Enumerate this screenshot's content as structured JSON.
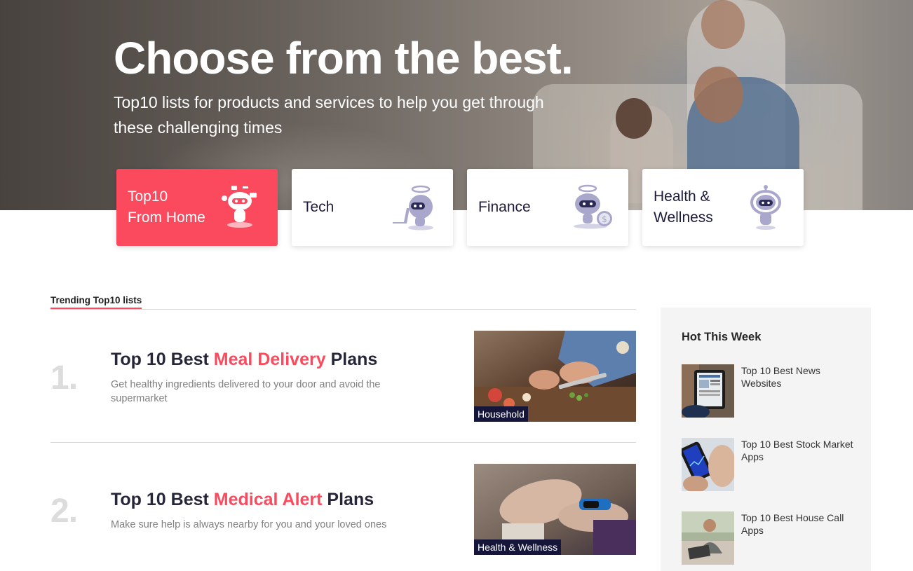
{
  "hero": {
    "title": "Choose from the best.",
    "subtitle": "Top10 lists for products and services to help you get through these challenging times"
  },
  "categories": [
    {
      "label": "Top10\nFrom Home",
      "icon": "robot-home-icon",
      "active": true
    },
    {
      "label": "Tech",
      "icon": "robot-tech-icon",
      "active": false
    },
    {
      "label": "Finance",
      "icon": "robot-finance-icon",
      "active": false
    },
    {
      "label": "Health &\nWellness",
      "icon": "robot-health-icon",
      "active": false
    }
  ],
  "trending": {
    "heading": "Trending Top10 lists",
    "items": [
      {
        "number": "1.",
        "title_prefix": "Top 10 Best ",
        "title_highlight": "Meal Delivery",
        "title_suffix": " Plans",
        "description": "Get healthy ingredients delivered to your door and avoid the supermarket",
        "tag": "Household",
        "image": "meal-prep-photo"
      },
      {
        "number": "2.",
        "title_prefix": "Top 10 Best ",
        "title_highlight": "Medical Alert",
        "title_suffix": " Plans",
        "description": "Make sure help is always nearby for you and your loved ones",
        "tag": "Health & Wellness",
        "image": "senior-wristband-photo"
      }
    ]
  },
  "hot_this_week": {
    "heading": "Hot This Week",
    "items": [
      {
        "label": "Top 10 Best News Websites",
        "image": "tablet-news-photo"
      },
      {
        "label": "Top 10 Best Stock Market Apps",
        "image": "phone-stocks-photo"
      },
      {
        "label": "Top 10 Best House Call Apps",
        "image": "man-laptop-photo"
      }
    ]
  },
  "colors": {
    "accent": "#fb4a5e",
    "navy": "#15163a",
    "icon_lavender": "#a9a7cc"
  }
}
